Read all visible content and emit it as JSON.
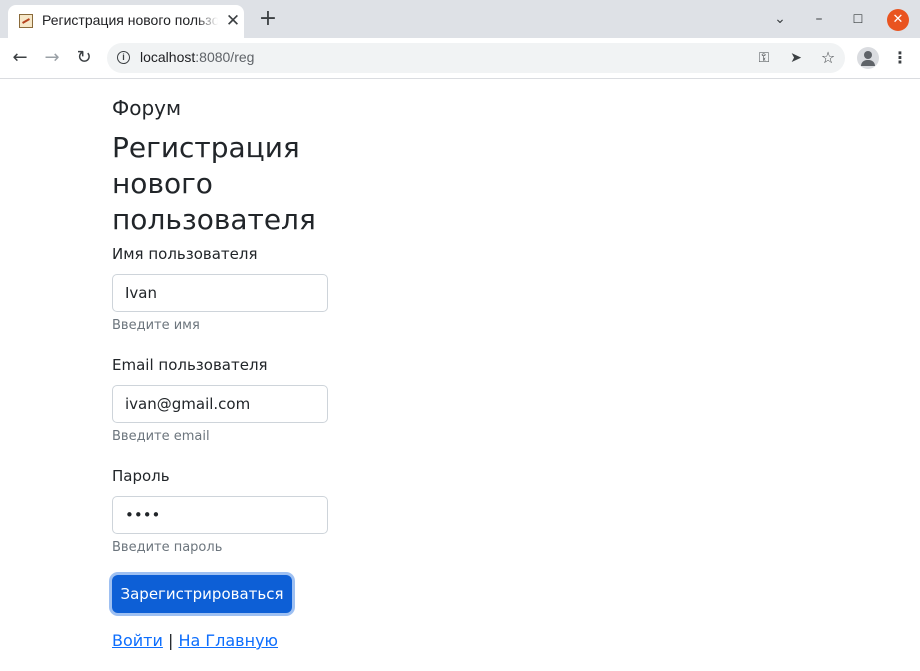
{
  "browser": {
    "tab_title": "Регистрация нового пользователя",
    "new_tab": "+",
    "url_host": "localhost",
    "url_rest": ":8080/reg"
  },
  "page": {
    "brand": "Форум",
    "heading": "Регистрация нового пользователя",
    "fields": [
      {
        "label": "Имя пользователя",
        "value": "Ivan",
        "help": "Введите имя",
        "type": "text"
      },
      {
        "label": "Email пользователя",
        "value": "ivan@gmail.com",
        "help": "Введите email",
        "type": "email"
      },
      {
        "label": "Пароль",
        "value": "1234",
        "help": "Введите пароль",
        "type": "password"
      }
    ],
    "submit_label": "Зарегистрироваться",
    "login_link": "Войти",
    "separator": "|",
    "home_link": "На Главную"
  },
  "icons": [
    "tab-favicon-icon",
    "close-icon",
    "back-arrow-icon",
    "forward-arrow-icon",
    "reload-icon",
    "info-icon",
    "key-icon",
    "send-icon",
    "star-icon",
    "profile-icon",
    "menu-icon",
    "chevron-down-icon",
    "minimize-icon",
    "maximize-icon"
  ],
  "colors": {
    "primary": "#0d5fd6",
    "link": "#0d6efd",
    "window_close": "#e95420"
  }
}
